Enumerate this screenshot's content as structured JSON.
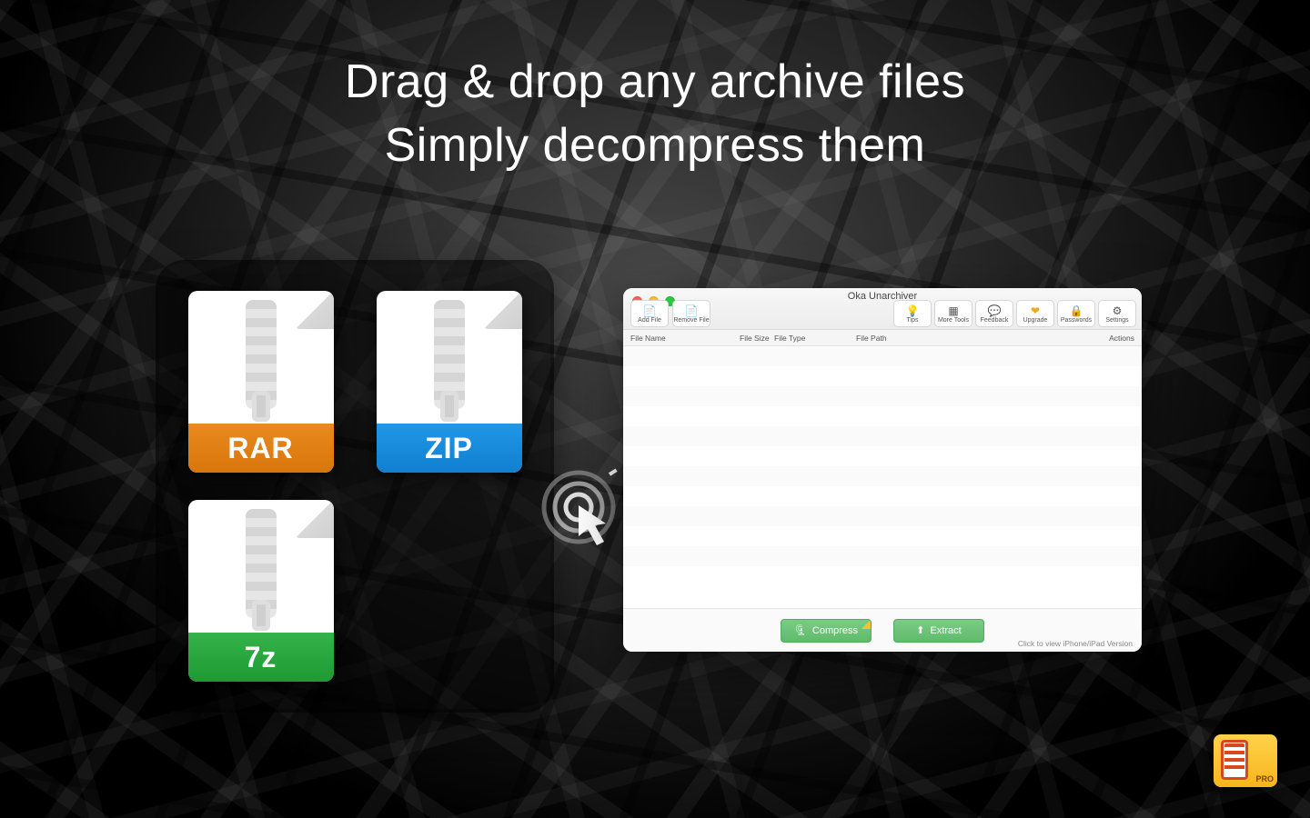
{
  "promo": {
    "line1": "Drag & drop any archive files",
    "line2": "Simply decompress them"
  },
  "archive_tiles": {
    "rar": "RAR",
    "zip": "ZIP",
    "sevenz": "7z"
  },
  "window": {
    "title": "Oka Unarchiver",
    "toolbar_left": {
      "add_file": "Add File",
      "remove_file": "Remove File"
    },
    "toolbar_right": {
      "tips": "Tips",
      "more_tools": "More Tools",
      "feedback": "Feedback",
      "upgrade": "Upgrade",
      "passwords": "Passwords",
      "settings": "Settings"
    },
    "columns": {
      "file_name": "File Name",
      "file_size": "File Size",
      "file_type": "File Type",
      "file_path": "File Path",
      "actions": "Actions"
    },
    "action_buttons": {
      "compress": "Compress",
      "extract": "Extract"
    },
    "footer_hint": "Click to view iPhone/iPad Version"
  },
  "badge": {
    "label": "PRO"
  },
  "colors": {
    "rar": "#e07f12",
    "zip": "#1a8ad8",
    "sevenz": "#28a63a",
    "action_green": "#6bc176"
  }
}
